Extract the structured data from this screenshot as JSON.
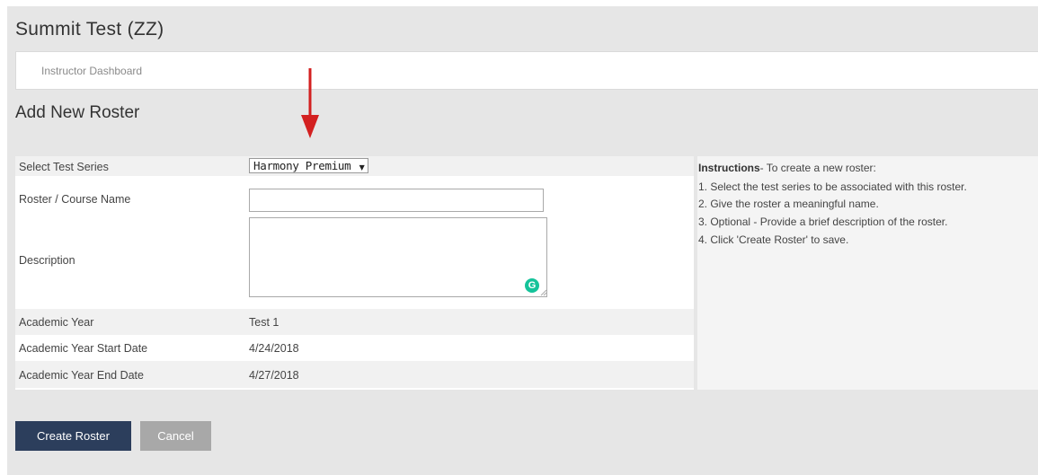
{
  "app": {
    "title": "Summit Test (ZZ)"
  },
  "nav": {
    "items": [
      {
        "label": "Instructor Dashboard"
      }
    ]
  },
  "page": {
    "section_title": "Add New Roster"
  },
  "form": {
    "test_series": {
      "label": "Select Test Series",
      "value": "Harmony Premium"
    },
    "roster_name": {
      "label": "Roster / Course Name",
      "value": "",
      "placeholder": ""
    },
    "description": {
      "label": "Description",
      "value": "",
      "grammarly_glyph": "G"
    },
    "academic_year": {
      "label": "Academic Year",
      "value": "Test 1"
    },
    "start_date": {
      "label": "Academic Year Start Date",
      "value": "4/24/2018"
    },
    "end_date": {
      "label": "Academic Year End Date",
      "value": "4/27/2018"
    }
  },
  "instructions": {
    "heading": "Instructions",
    "intro": "- To create a new roster:",
    "steps": [
      "1. Select the test series to be associated with this roster.",
      "2. Give the roster a meaningful name.",
      "3. Optional - Provide a brief description of the roster.",
      "4. Click 'Create Roster' to save."
    ]
  },
  "buttons": {
    "create": "Create Roster",
    "cancel": "Cancel"
  },
  "colors": {
    "primary": "#2c3e5c",
    "cancel": "#a8a8a8",
    "arrow": "#d32020",
    "grammarly": "#15c39a",
    "panel": "#e6e6e6"
  },
  "icons": {
    "arrow": "down-arrow-icon",
    "grammarly": "grammarly-icon",
    "dropdown": "caret-down-icon"
  }
}
